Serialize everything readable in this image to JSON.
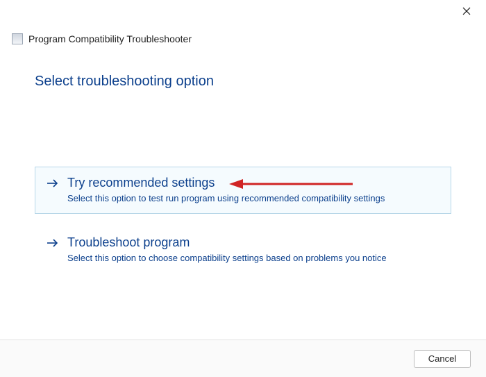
{
  "window": {
    "app_title": "Program Compatibility Troubleshooter"
  },
  "page": {
    "title": "Select troubleshooting option"
  },
  "options": {
    "recommended": {
      "title": "Try recommended settings",
      "description": "Select this option to test run program using recommended compatibility settings"
    },
    "troubleshoot": {
      "title": "Troubleshoot program",
      "description": "Select this option to choose compatibility settings based on problems you notice"
    }
  },
  "footer": {
    "cancel_label": "Cancel"
  },
  "colors": {
    "accent": "#0b3f8c",
    "highlight_border": "#b7d7e8",
    "highlight_bg": "#f5fbfe",
    "annotation": "#d02424"
  }
}
